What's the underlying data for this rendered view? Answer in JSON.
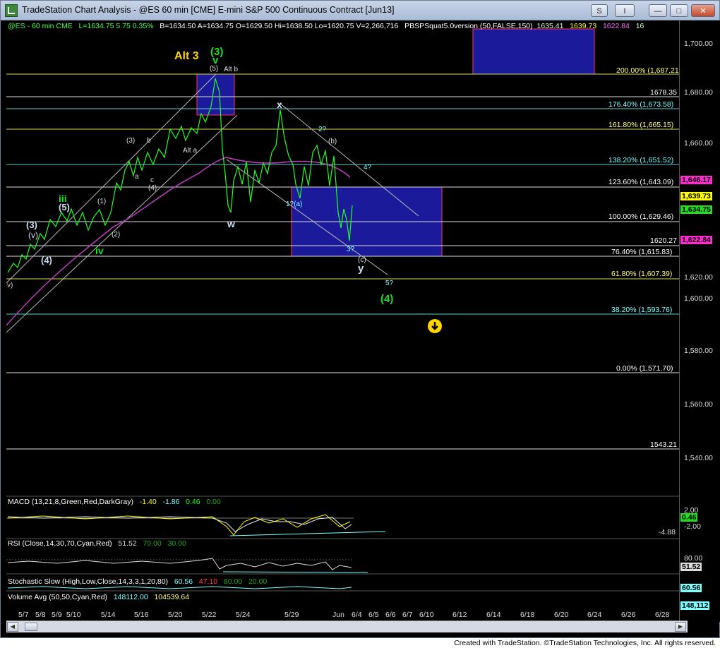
{
  "window": {
    "title": "TradeStation Chart Analysis - @ES 60 min [CME] E-mini S&P 500 Continuous Contract [Jun13]",
    "buttons": {
      "s": "S",
      "i": "I",
      "min": "—",
      "max": "□",
      "close": "✕"
    }
  },
  "info_line": {
    "symbol": "@ES - 60 min  CME",
    "last": "L=1634.75  5.75   0.35%",
    "quotes": "B=1634.50  A=1634.75  O=1629.50  Hi=1638.50  Lo=1620.75  V=2,266,716",
    "study": "PBSPSquat5.0version (50,FALSE,150)",
    "v1": "1635.41",
    "v2": "1639.73",
    "v3": "1622.84",
    "v4": "16"
  },
  "price_axis": {
    "labels": [
      "1,700.00",
      "1,680.00",
      "1,660.00",
      "1,640.00",
      "1,620.00",
      "1,600.00",
      "1,580.00",
      "1,560.00",
      "1,540.00"
    ],
    "boxes": [
      {
        "text": "1,646.17",
        "color": "#ff2ad0"
      },
      {
        "text": "1,639.73",
        "color": "#ffff00"
      },
      {
        "text": "1,634.75",
        "color": "#22dd22"
      },
      {
        "text": "1,622.84",
        "color": "#ff2ad0"
      }
    ],
    "macd_labels": [
      "2.00",
      "0.46",
      "-2.00"
    ],
    "macd_box": "0.46",
    "rsi_labels": [
      "80.00"
    ],
    "rsi_box": "51.52",
    "stoch_box": "60.56",
    "vol_box": "148,112"
  },
  "fib_levels": [
    {
      "label": "200.00% (1,687.21)",
      "color": "#ffff80"
    },
    {
      "label": "1678.35",
      "color": "#ffffff"
    },
    {
      "label": "176.40% (1,673.58)",
      "color": "#7fffff"
    },
    {
      "label": "161.80% (1,665.15)",
      "color": "#ffff80"
    },
    {
      "label": "138.20% (1,651.52)",
      "color": "#7fffff"
    },
    {
      "label": "123.60% (1,643.09)",
      "color": "#ffffff"
    },
    {
      "label": "100.00% (1,629.46)",
      "color": "#ffffff"
    },
    {
      "label": "1620.27",
      "color": "#ffffff"
    },
    {
      "label": "76.40% (1,615.83)",
      "color": "#ffffff"
    },
    {
      "label": "61.80% (1,607.39)",
      "color": "#ffff80"
    },
    {
      "label": "38.20% (1,593.76)",
      "color": "#7fffff"
    },
    {
      "label": "0.00% (1,571.70)",
      "color": "#ffffff"
    },
    {
      "label": "1543.21",
      "color": "#ffffff"
    }
  ],
  "waves": {
    "alt3": "Alt 3",
    "three_paren": "(3)",
    "v_green": "v",
    "five_paren": "(5)",
    "alt_b": "Alt b",
    "alt_a": "Alt a",
    "x": "x",
    "w": "w",
    "y": "y",
    "two_q": "2?",
    "b_paren": "(b)",
    "four_q": "4?",
    "one_q_a": "1?(a)",
    "three_q": "3?",
    "c_paren": "(c)",
    "five_q": "5?",
    "four_paren": "(4)",
    "three_l": "(3)",
    "b_l": "b",
    "a_l": "a",
    "c_l": "c",
    "four_l": "(4)",
    "iii": "iii",
    "five_l": "(5)",
    "one_l": "(1)",
    "two_l": "(2)",
    "iv": "iv",
    "three_left": "(3)",
    "v_left": "(v)",
    "four_left": "(4)",
    "v_edge": "v)"
  },
  "indicators": {
    "macd": {
      "label": "MACD (13,21,8,Green,Red,DarkGray)",
      "v1": "-1.40",
      "v2": "-1.86",
      "v3": "0.46",
      "v4": "0.00",
      "level": "-4.88"
    },
    "rsi": {
      "label": "RSI (Close,14,30,70,Cyan,Red)",
      "v1": "51.52",
      "v2": "70.00",
      "v3": "30.00"
    },
    "stoch": {
      "label": "Stochastic Slow (High,Low,Close,14,3,3,1,20,80)",
      "v1": "60.56",
      "v2": "47.10",
      "v3": "80.00",
      "v4": "20.00"
    },
    "volume": {
      "label": "Volume Avg (50,50,Cyan,Red)",
      "v1": "148112.00",
      "v2": "104539.64"
    }
  },
  "date_axis": [
    "5/7",
    "5/8",
    "5/9",
    "5/10",
    "5/14",
    "5/16",
    "5/20",
    "5/22",
    "5/24",
    "5/29",
    "Jun",
    "6/4",
    "6/5",
    "6/6",
    "6/7",
    "6/10",
    "6/12",
    "6/14",
    "6/18",
    "6/20",
    "6/24",
    "6/26",
    "6/28"
  ],
  "footer": "Created with TradeStation. ©TradeStation Technologies, Inc. All rights reserved.",
  "colors": {
    "price_bar": "#22ff22",
    "ma": "#c23dc2",
    "fib_line": "#bfbf60",
    "box": "#1a1a9a",
    "box_border": "#ff3366"
  }
}
